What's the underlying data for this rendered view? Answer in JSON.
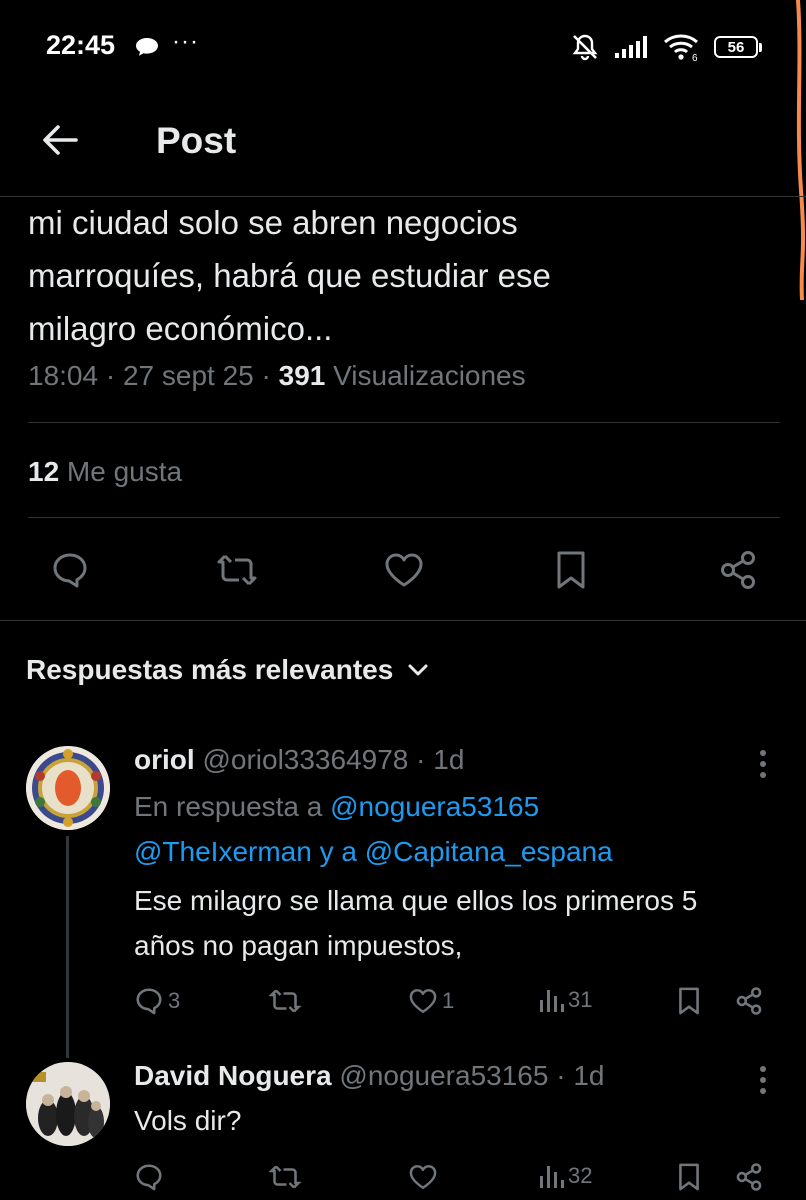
{
  "status_bar": {
    "time": "22:45",
    "dots": "···",
    "battery": "56"
  },
  "header": {
    "title": "Post"
  },
  "tweet": {
    "text_line1": "mi ciudad solo se abren negocios",
    "text_line2": "marroquíes, habrá que estudiar ese",
    "text_line3": "milagro económico...",
    "time": "18:04",
    "sep1": " · ",
    "date": "27 sept 25",
    "sep2": " · ",
    "views_count": "391",
    "views_label": " Visualizaciones",
    "likes_count": "12",
    "likes_label": " Me gusta"
  },
  "replies_section": {
    "title": "Respuestas más relevantes"
  },
  "replies": [
    {
      "name": "oriol",
      "handle": "@oriol33364978",
      "time": " · 1d",
      "context_prefix": "En respuesta a ",
      "mention1": "@noguera53165",
      "mention2": "@TheIxerman",
      "context_mid": " y a ",
      "mention3": "@Capitana_espana",
      "text_line1": "Ese milagro se llama que ellos los primeros 5",
      "text_line2": "años no pagan impuestos,",
      "replies_count": "3",
      "retweets_count": "",
      "likes_count": "1",
      "views_count": "31"
    },
    {
      "name": "David Noguera",
      "handle": "@noguera53165",
      "time": " · 1d",
      "text": "Vols dir?",
      "replies_count": "",
      "retweets_count": "",
      "likes_count": "",
      "views_count": "32"
    }
  ],
  "colors": {
    "background": "#000000",
    "text": "#e7e9ea",
    "muted": "#71767b",
    "link": "#1d9bf0",
    "border": "#2f3336",
    "annotation_stroke": "#f58a4b"
  },
  "icons": [
    "back-arrow-icon",
    "reply-icon",
    "retweet-icon",
    "like-icon",
    "bookmark-icon",
    "share-icon",
    "chevron-down-icon",
    "more-icon",
    "views-icon",
    "chat-bubble-icon",
    "mute-icon",
    "signal-icon",
    "wifi-icon",
    "battery-icon"
  ]
}
